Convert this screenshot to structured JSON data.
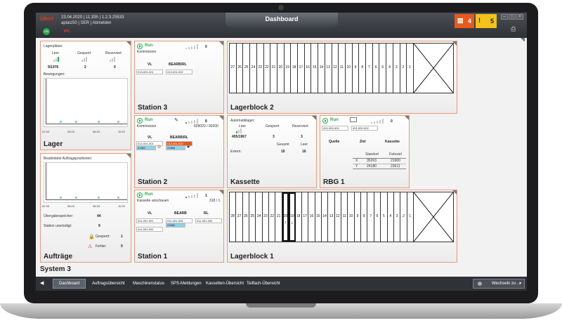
{
  "header": {
    "logo": "ident",
    "meta_line1": "23.04.2020 | 11:33h | 1.2.3.25533",
    "meta_line2": "aplatz50 | SER | Abmelden",
    "status_db": "DB",
    "status_ipc": "IPC",
    "title": "Dashboard",
    "alert_red_count": "4",
    "alert_yellow_count": "5",
    "win_min": "–",
    "win_max": "□",
    "win_close": "×"
  },
  "lager": {
    "title": "Lager",
    "lagerplaetze_label": "Lagerplätze:",
    "col_leer": "Leer",
    "col_gesperrt": "Gesperrt",
    "col_reserviert": "Reserviert",
    "val_leer": "9/1976",
    "val_gesperrt": "2",
    "val_reserviert": "0",
    "bewegungen_label": "Bewegungen:",
    "ticks": [
      "02:33",
      "05:03",
      "08:33",
      "11:03"
    ]
  },
  "auftraege": {
    "title": "Aufträge",
    "chart_label": "Bearbeitete Auftragspositionen:",
    "ticks": [
      "02:33",
      "05:03",
      "08:33",
      "11:03"
    ],
    "uebergabe_label": "Übergabespeicher:",
    "uebergabe_val": "44",
    "station_label": "Station unerledigt:",
    "station_val": "9",
    "gesperrt_label": "Gesperrt:",
    "gesperrt_val": "1",
    "fehler_label": "Fehler:",
    "fehler_val": "0"
  },
  "station3": {
    "title": "Station 3",
    "run": "Run",
    "mode": "Kommission",
    "count": "0",
    "col_vl": "VL",
    "col_bearb": "BEARB/RL",
    "cell_vl": "013-001-001",
    "cell_bearb": "013-001-002"
  },
  "station2": {
    "title": "Station 2",
    "run": "Run",
    "mode": "Kommission",
    "count": "8",
    "progress": "828020 / 00200",
    "col_vl": "VL",
    "col_bearb": "BEARB/RL",
    "cell_vl": "012-001-001",
    "cell_vl_sub": "21861",
    "cell_bearb": "012-001-002",
    "cell_bearb_sub": "21866"
  },
  "station1": {
    "title": "Station 1",
    "run": "Run",
    "mode": "Kassette anschauen",
    "count": "1",
    "progress": "318 / 1",
    "col_vl": "VL",
    "col_bearb": "BEARB",
    "col_rl": "RL",
    "cell_vl1": "011-001-001",
    "cell_vl2": "011-001-002",
    "cell_bearb": "011-001-003",
    "cell_bearb_sub": "22882",
    "cell_rl": "011-001-004"
  },
  "kassette": {
    "title": "Kassette",
    "label": "Automatiklager:",
    "col_leer": "Leer",
    "col_gesperrt": "Gesperrt",
    "col_reserviert": "Reserviert",
    "val_leer": "405/1967",
    "val_gesperrt": "3",
    "val_reserviert": "3",
    "col_gesamt": "Gesamt",
    "col_leer2": "Leer",
    "extern_label": "Extern:",
    "extern_gesamt": "16",
    "extern_leer": "16"
  },
  "rbg1": {
    "title": "RBG 1",
    "run": "Run",
    "count": "0",
    "cell1": "001-000-001",
    "cell2": "001-000-002",
    "col_quelle": "Quelle",
    "col_ziel": "Ziel",
    "col_kassette": "Kassette",
    "col_standort": "Standort",
    "col_fahrziel": "Fahrziel",
    "row_x": "X",
    "row_y": "Y",
    "x_standort": "35263",
    "x_fahrziel": "21900",
    "y_standort": "24180",
    "y_fahrziel": "23611"
  },
  "lagerblock2": {
    "title": "Lagerblock 2",
    "cells": [
      "27",
      "26",
      "25",
      "24",
      "23",
      "22",
      "21",
      "20",
      "19",
      "18",
      "17",
      "16",
      "15",
      "14",
      "13",
      "12",
      "11",
      "10",
      "9",
      "8",
      "7",
      "6",
      "5",
      "4",
      "3",
      "2",
      "1"
    ]
  },
  "lagerblock1": {
    "title": "Lagerblock 1",
    "cells": [
      "28",
      "27",
      "26",
      "25",
      "24",
      "23",
      "22",
      "21",
      "20",
      "19",
      "18",
      "17",
      "16",
      "15",
      "14",
      "13",
      "12",
      "11",
      "10",
      "9",
      "8",
      "7",
      "6",
      "5",
      "4",
      "3",
      "2",
      "1"
    ]
  },
  "system": {
    "title": "System 3"
  },
  "nav": {
    "back": "◀",
    "items": [
      "Dashboard",
      "Auftragsübersicht",
      "Maschinenstatus",
      "SPS-Meldungen",
      "Kassetten-Übersicht",
      "Teilfach-Übersicht"
    ],
    "switch": "Wechseln zu ..."
  }
}
